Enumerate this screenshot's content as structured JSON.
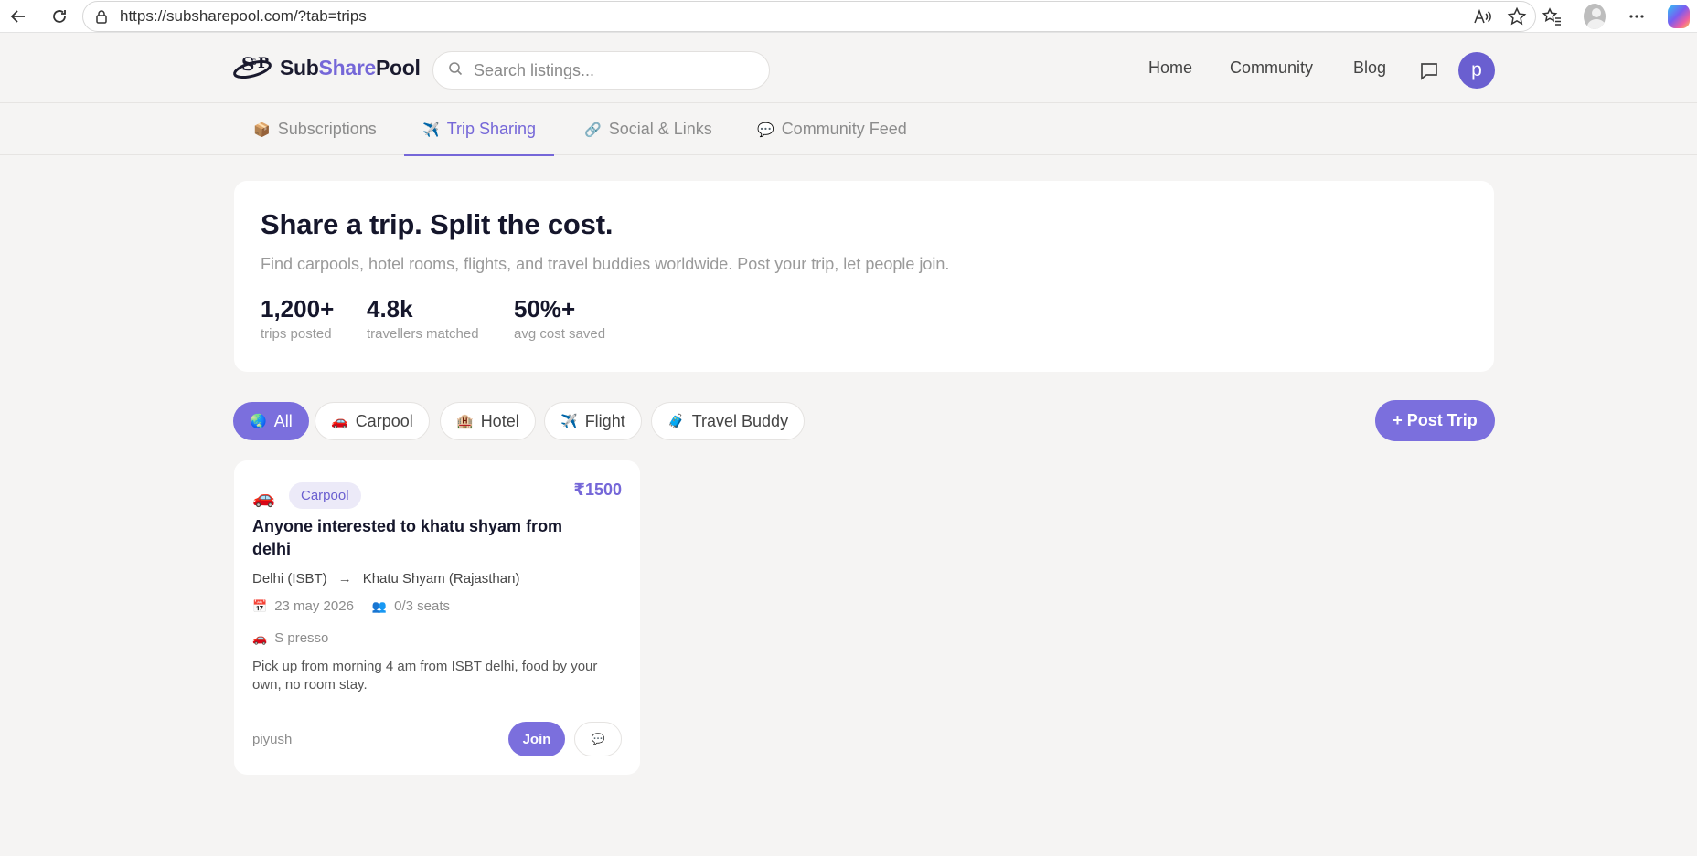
{
  "browser": {
    "url": "https://subsharepool.com/?tab=trips",
    "icons": [
      "back-arrow-icon",
      "reload-icon",
      "lock-icon",
      "read-aloud-icon",
      "favorite-star-icon",
      "favorites-icon",
      "profile-icon",
      "more-icon",
      "copilot-icon"
    ]
  },
  "header": {
    "logo_part1": "Sub",
    "logo_part2": "Share",
    "logo_part3": "Pool",
    "search_placeholder": "Search listings...",
    "nav": [
      "Home",
      "Community",
      "Blog"
    ],
    "avatar_letter": "p"
  },
  "tabs": [
    {
      "emoji": "📦",
      "label": "Subscriptions"
    },
    {
      "emoji": "✈️",
      "label": "Trip Sharing",
      "active": true
    },
    {
      "emoji": "🔗",
      "label": "Social & Links"
    },
    {
      "emoji": "💬",
      "label": "Community Feed"
    }
  ],
  "hero": {
    "title": "Share a trip. Split the cost.",
    "subtitle": "Find carpools, hotel rooms, flights, and travel buddies worldwide. Post your trip, let people join.",
    "stats": [
      {
        "value": "1,200+",
        "label": "trips posted"
      },
      {
        "value": "4.8k",
        "label": "travellers matched"
      },
      {
        "value": "50%+",
        "label": "avg cost saved"
      }
    ]
  },
  "filters": [
    {
      "emoji": "🌏",
      "label": "All",
      "active": true
    },
    {
      "emoji": "🚗",
      "label": "Carpool"
    },
    {
      "emoji": "🏨",
      "label": "Hotel"
    },
    {
      "emoji": "✈️",
      "label": "Flight"
    },
    {
      "emoji": "🧳",
      "label": "Travel Buddy"
    }
  ],
  "post_button": "+ Post Trip",
  "trip": {
    "vehicle_emoji": "🚗",
    "type": "Carpool",
    "price": "₹1500",
    "title": "Anyone interested to khatu shyam from delhi",
    "from": "Delhi (ISBT)",
    "arrow": "→",
    "to": "Khatu Shyam (Rajasthan)",
    "date_emoji": "📅",
    "date": "23 may 2026",
    "seats_emoji": "👥",
    "seats": "0/3 seats",
    "car_emoji": "🚗",
    "car": "S presso",
    "description": "Pick up from morning 4 am from ISBT delhi, food by your own, no room stay.",
    "owner": "piyush",
    "join": "Join",
    "chat_emoji": "💬"
  },
  "colors": {
    "accent": "#7b6fdd",
    "accent_text": "#7567d8",
    "page_bg": "#f5f4f3",
    "card_bg": "#ffffff"
  }
}
